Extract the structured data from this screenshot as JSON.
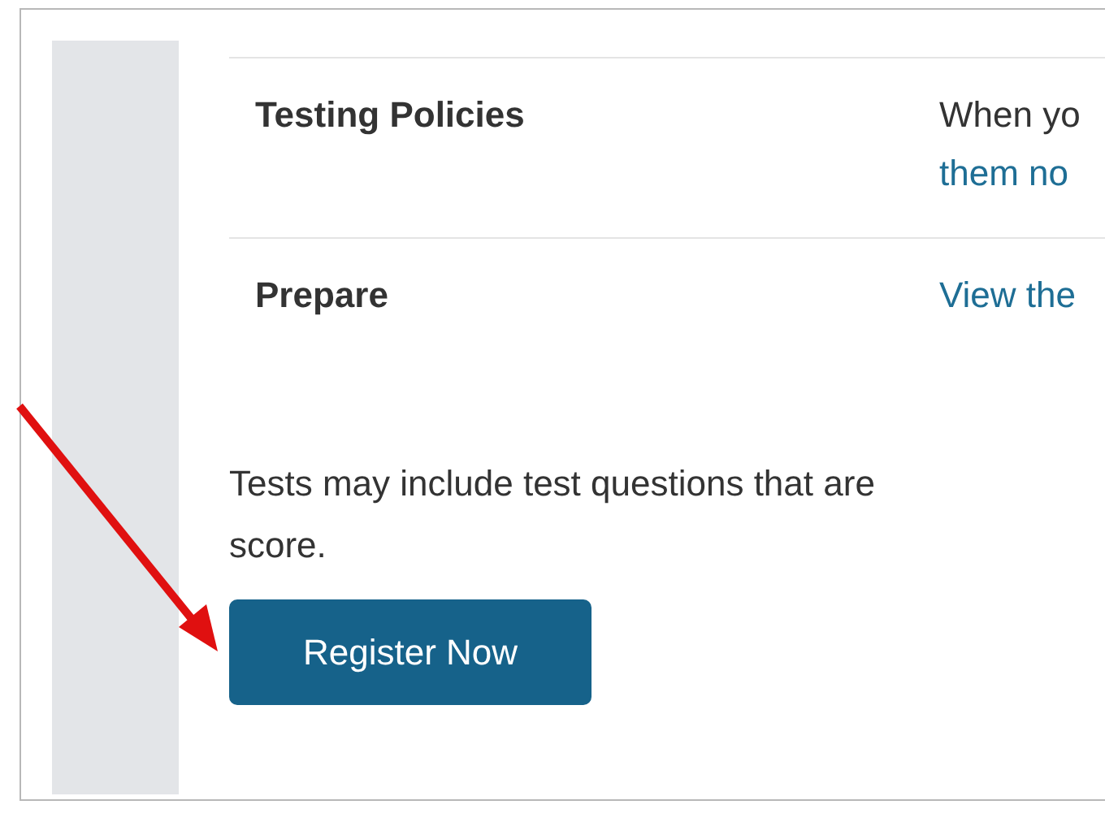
{
  "details": [
    {
      "label": "Testing Policies",
      "lines": [
        {
          "text": "When yo",
          "link": false
        },
        {
          "text": "them no",
          "link": true
        }
      ]
    },
    {
      "label": "Prepare",
      "lines": [
        {
          "text": "View the",
          "link": true
        }
      ]
    }
  ],
  "note": [
    "Tests may include test questions that are",
    "score."
  ],
  "button": {
    "label": "Register Now"
  },
  "annotation": {
    "kind": "arrow"
  }
}
